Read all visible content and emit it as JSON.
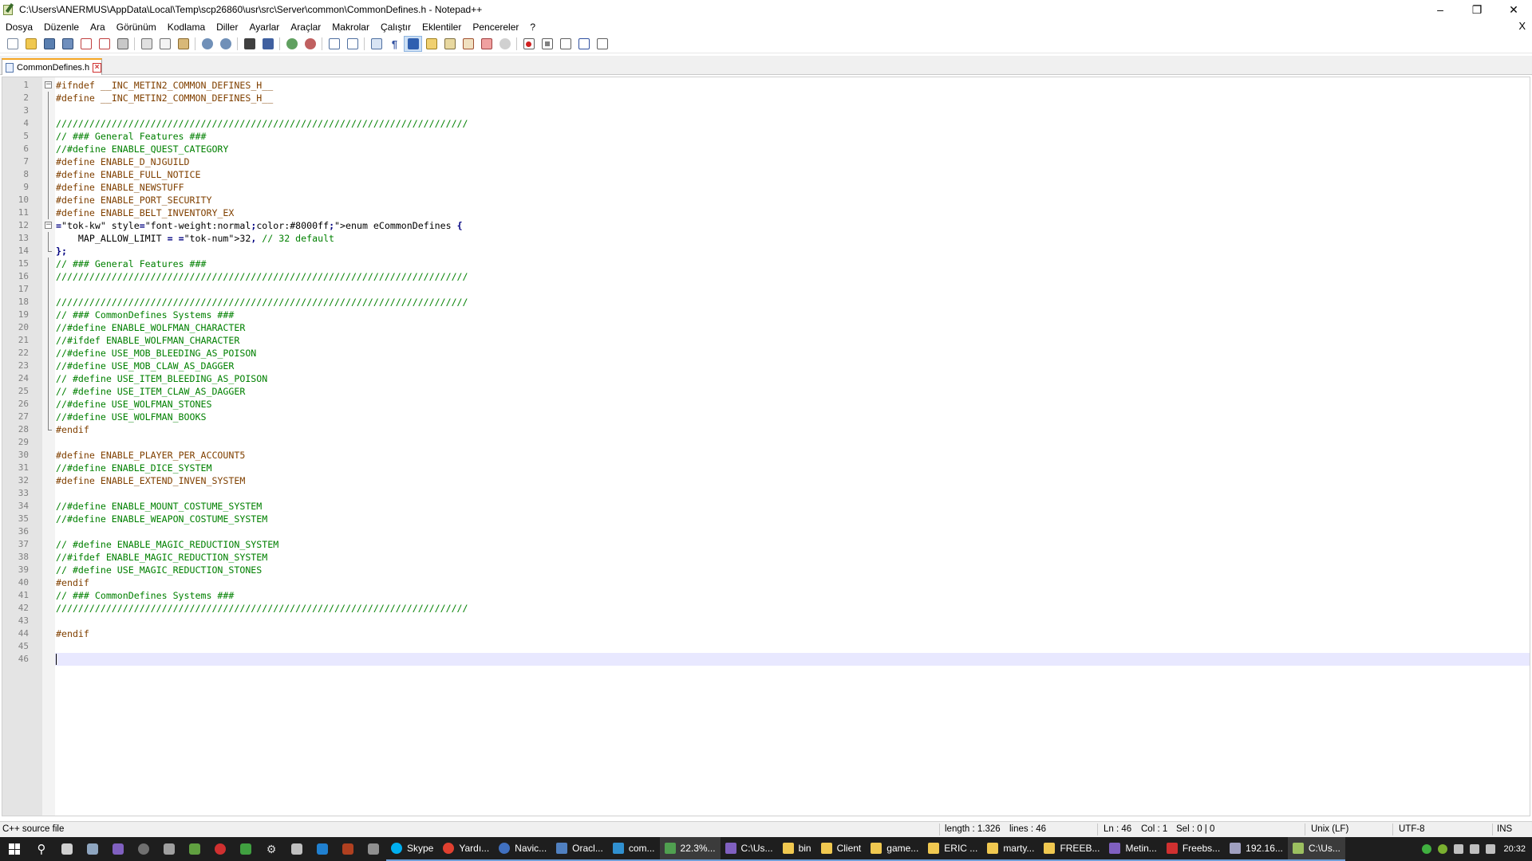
{
  "window": {
    "title": "C:\\Users\\ANERMUS\\AppData\\Local\\Temp\\scp26860\\usr\\src\\Server\\common\\CommonDefines.h - Notepad++"
  },
  "menu": [
    "Dosya",
    "Düzenle",
    "Ara",
    "Görünüm",
    "Kodlama",
    "Diller",
    "Ayarlar",
    "Araçlar",
    "Makrolar",
    "Çalıştır",
    "Eklentiler",
    "Pencereler",
    "?"
  ],
  "menu_close": "X",
  "tab": {
    "label": "CommonDefines.h"
  },
  "code_lines": [
    "#ifndef __INC_METIN2_COMMON_DEFINES_H__",
    "#define __INC_METIN2_COMMON_DEFINES_H__",
    "",
    "//////////////////////////////////////////////////////////////////////////",
    "// ### General Features ###",
    "//#define ENABLE_QUEST_CATEGORY",
    "#define ENABLE_D_NJGUILD",
    "#define ENABLE_FULL_NOTICE",
    "#define ENABLE_NEWSTUFF",
    "#define ENABLE_PORT_SECURITY",
    "#define ENABLE_BELT_INVENTORY_EX",
    "enum eCommonDefines {",
    "    MAP_ALLOW_LIMIT = 32, // 32 default",
    "};",
    "// ### General Features ###",
    "//////////////////////////////////////////////////////////////////////////",
    "",
    "//////////////////////////////////////////////////////////////////////////",
    "// ### CommonDefines Systems ###",
    "//#define ENABLE_WOLFMAN_CHARACTER",
    "//#ifdef ENABLE_WOLFMAN_CHARACTER",
    "//#define USE_MOB_BLEEDING_AS_POISON",
    "//#define USE_MOB_CLAW_AS_DAGGER",
    "// #define USE_ITEM_BLEEDING_AS_POISON",
    "// #define USE_ITEM_CLAW_AS_DAGGER",
    "//#define USE_WOLFMAN_STONES",
    "//#define USE_WOLFMAN_BOOKS",
    "#endif",
    "",
    "#define ENABLE_PLAYER_PER_ACCOUNT5",
    "//#define ENABLE_DICE_SYSTEM",
    "#define ENABLE_EXTEND_INVEN_SYSTEM",
    "",
    "//#define ENABLE_MOUNT_COSTUME_SYSTEM",
    "//#define ENABLE_WEAPON_COSTUME_SYSTEM",
    "",
    "// #define ENABLE_MAGIC_REDUCTION_SYSTEM",
    "//#ifdef ENABLE_MAGIC_REDUCTION_SYSTEM",
    "// #define USE_MAGIC_REDUCTION_STONES",
    "#endif",
    "// ### CommonDefines Systems ###",
    "//////////////////////////////////////////////////////////////////////////",
    "",
    "#endif",
    "",
    ""
  ],
  "status": {
    "file_type": "C++ source file",
    "length": "length : 1.326",
    "lines": "lines : 46",
    "ln": "Ln : 46",
    "col": "Col : 1",
    "sel": "Sel : 0 | 0",
    "eol": "Unix (LF)",
    "encoding": "UTF-8",
    "mode": "INS"
  },
  "taskbar": {
    "tasks": [
      "Skype",
      "Yardı...",
      "Navic...",
      "Oracl...",
      "com...",
      "22.3%...",
      "C:\\Us...",
      "bin",
      "Client",
      "game...",
      "ERIC ...",
      "marty...",
      "FREEB...",
      "Metin...",
      "Freebs...",
      "192.16...",
      "C:\\Us..."
    ],
    "clock": "20:32"
  }
}
